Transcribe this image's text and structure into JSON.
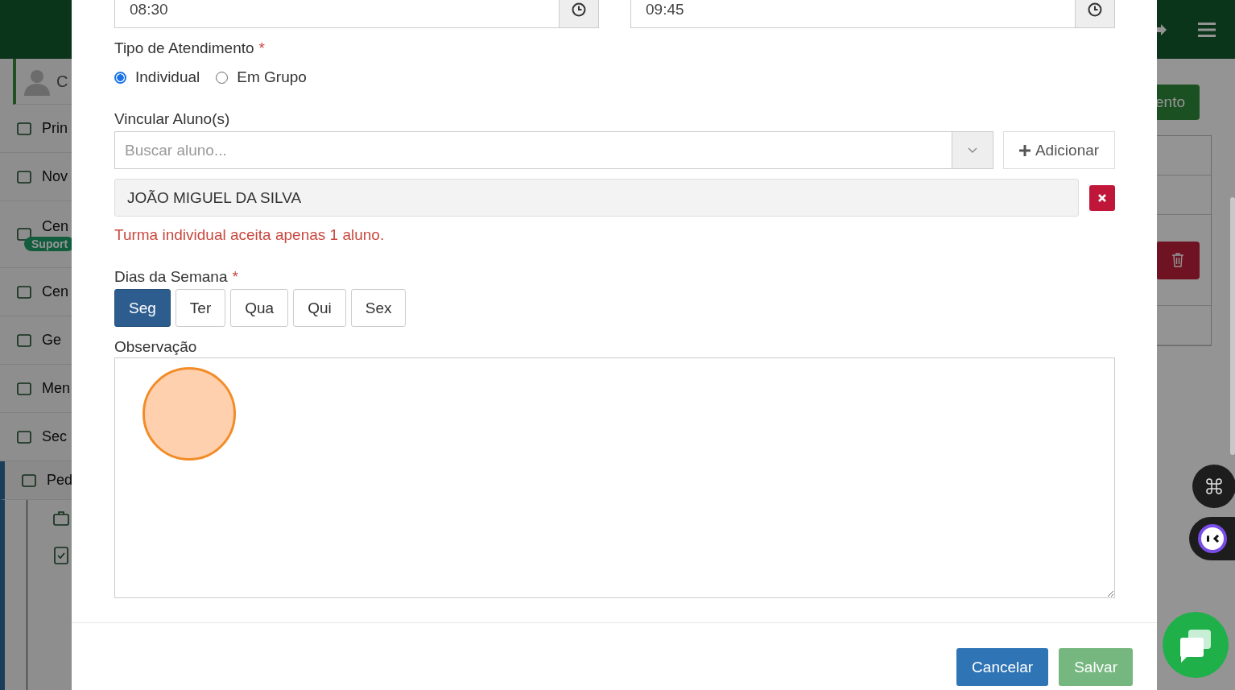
{
  "sidebar": {
    "profile_name": "C",
    "items": [
      {
        "label": "Prin",
        "selected": false
      },
      {
        "label": "Nov",
        "selected": false
      },
      {
        "label": "Cen",
        "badge": "Suport",
        "selected": false
      },
      {
        "label": "Cen",
        "selected": false
      },
      {
        "label": "Ge",
        "selected": false
      },
      {
        "label": "Men",
        "selected": false
      },
      {
        "label": "Sec",
        "selected": false
      },
      {
        "label": "Ped",
        "selected": true
      }
    ]
  },
  "page": {
    "action_button": "ento"
  },
  "modal": {
    "start_time": "08:30",
    "end_time": "09:45",
    "type_field": {
      "label": "Tipo de Atendimento",
      "required_mark": "*",
      "options": [
        {
          "label": "Individual",
          "selected": true
        },
        {
          "label": "Em Grupo",
          "selected": false
        }
      ]
    },
    "students_field": {
      "label": "Vincular Aluno(s)",
      "placeholder": "Buscar aluno...",
      "add_button": "Adicionar",
      "students": [
        "JOÃO MIGUEL DA SILVA"
      ],
      "error": "Turma individual aceita apenas 1 aluno."
    },
    "days_field": {
      "label": "Dias da Semana",
      "required_mark": "*",
      "days": [
        {
          "label": "Seg",
          "selected": true
        },
        {
          "label": "Ter",
          "selected": false
        },
        {
          "label": "Qua",
          "selected": false
        },
        {
          "label": "Qui",
          "selected": false
        },
        {
          "label": "Sex",
          "selected": false
        }
      ]
    },
    "notes_field": {
      "label": "Observação"
    },
    "buttons": [
      {
        "label": "Cancelar",
        "kind": "primary",
        "disabled": false
      },
      {
        "label": "Salvar",
        "kind": "success",
        "disabled": true
      }
    ]
  }
}
